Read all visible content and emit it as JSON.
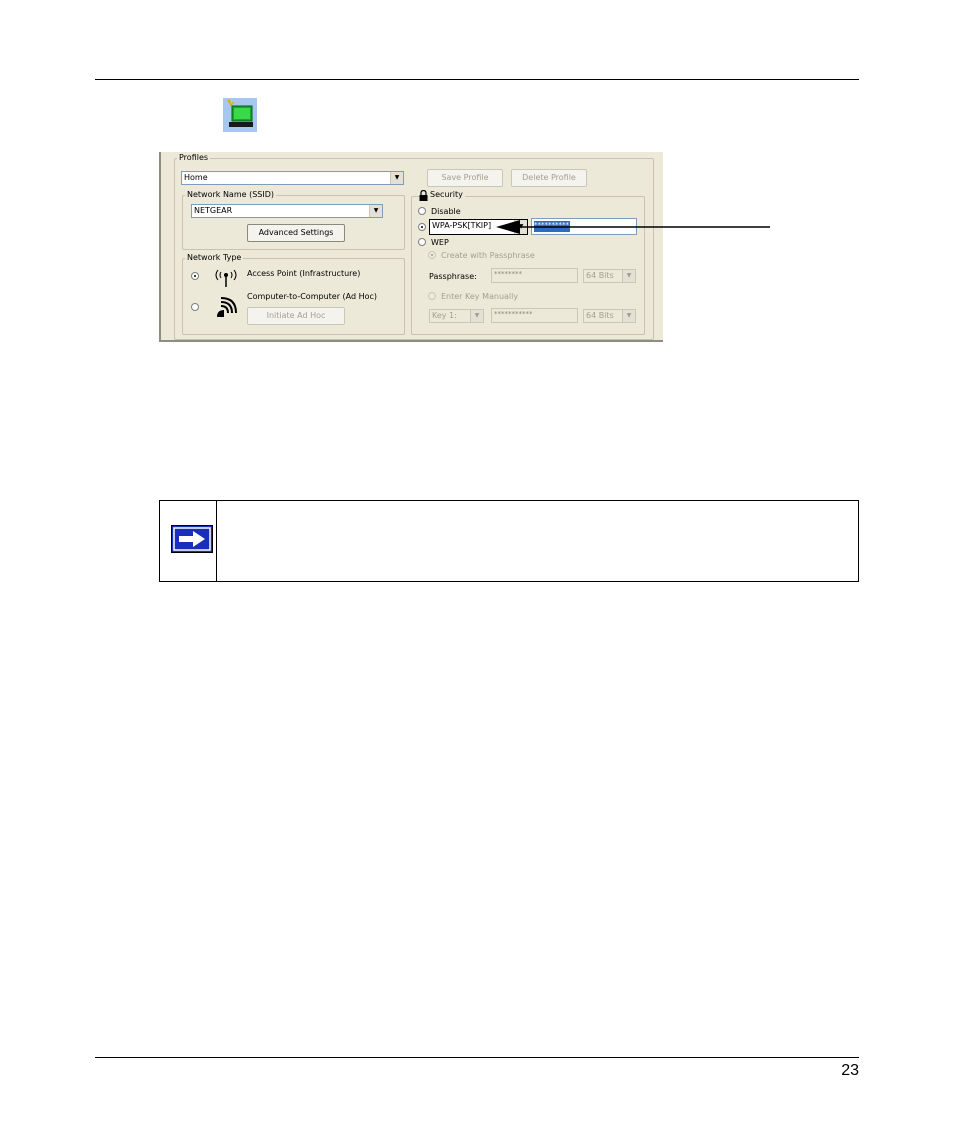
{
  "page": {
    "number": "23"
  },
  "profiles": {
    "legend": "Profiles",
    "selected": "Home",
    "save_button": "Save Profile",
    "delete_button": "Delete Profile"
  },
  "network_name": {
    "legend": "Network Name (SSID)",
    "ssid": "NETGEAR",
    "advanced_button": "Advanced Settings"
  },
  "network_type": {
    "legend": "Network Type",
    "access_point": "Access Point (Infrastructure)",
    "ad_hoc": "Computer-to-Computer (Ad Hoc)",
    "initiate_button": "Initiate Ad Hoc"
  },
  "security": {
    "legend": "Security",
    "disable": "Disable",
    "mode": "WPA-PSK[TKIP]",
    "mode_key": "**********",
    "wep": "WEP",
    "create_with_passphrase": "Create with Passphrase",
    "passphrase_label": "Passphrase:",
    "passphrase_value": "********",
    "bits_1": "64 Bits",
    "enter_key_manually": "Enter Key Manually",
    "key_select": "Key 1:",
    "key_value": "***********",
    "bits_2": "64 Bits"
  },
  "icons": {
    "tray": "wireless-utility-tray-icon",
    "note": "arrow-right-note-icon"
  },
  "colors": {
    "dialog_bg": "#ece9d8",
    "selection": "#316ac5",
    "note_arrow_bg": "#1a2fb8"
  }
}
